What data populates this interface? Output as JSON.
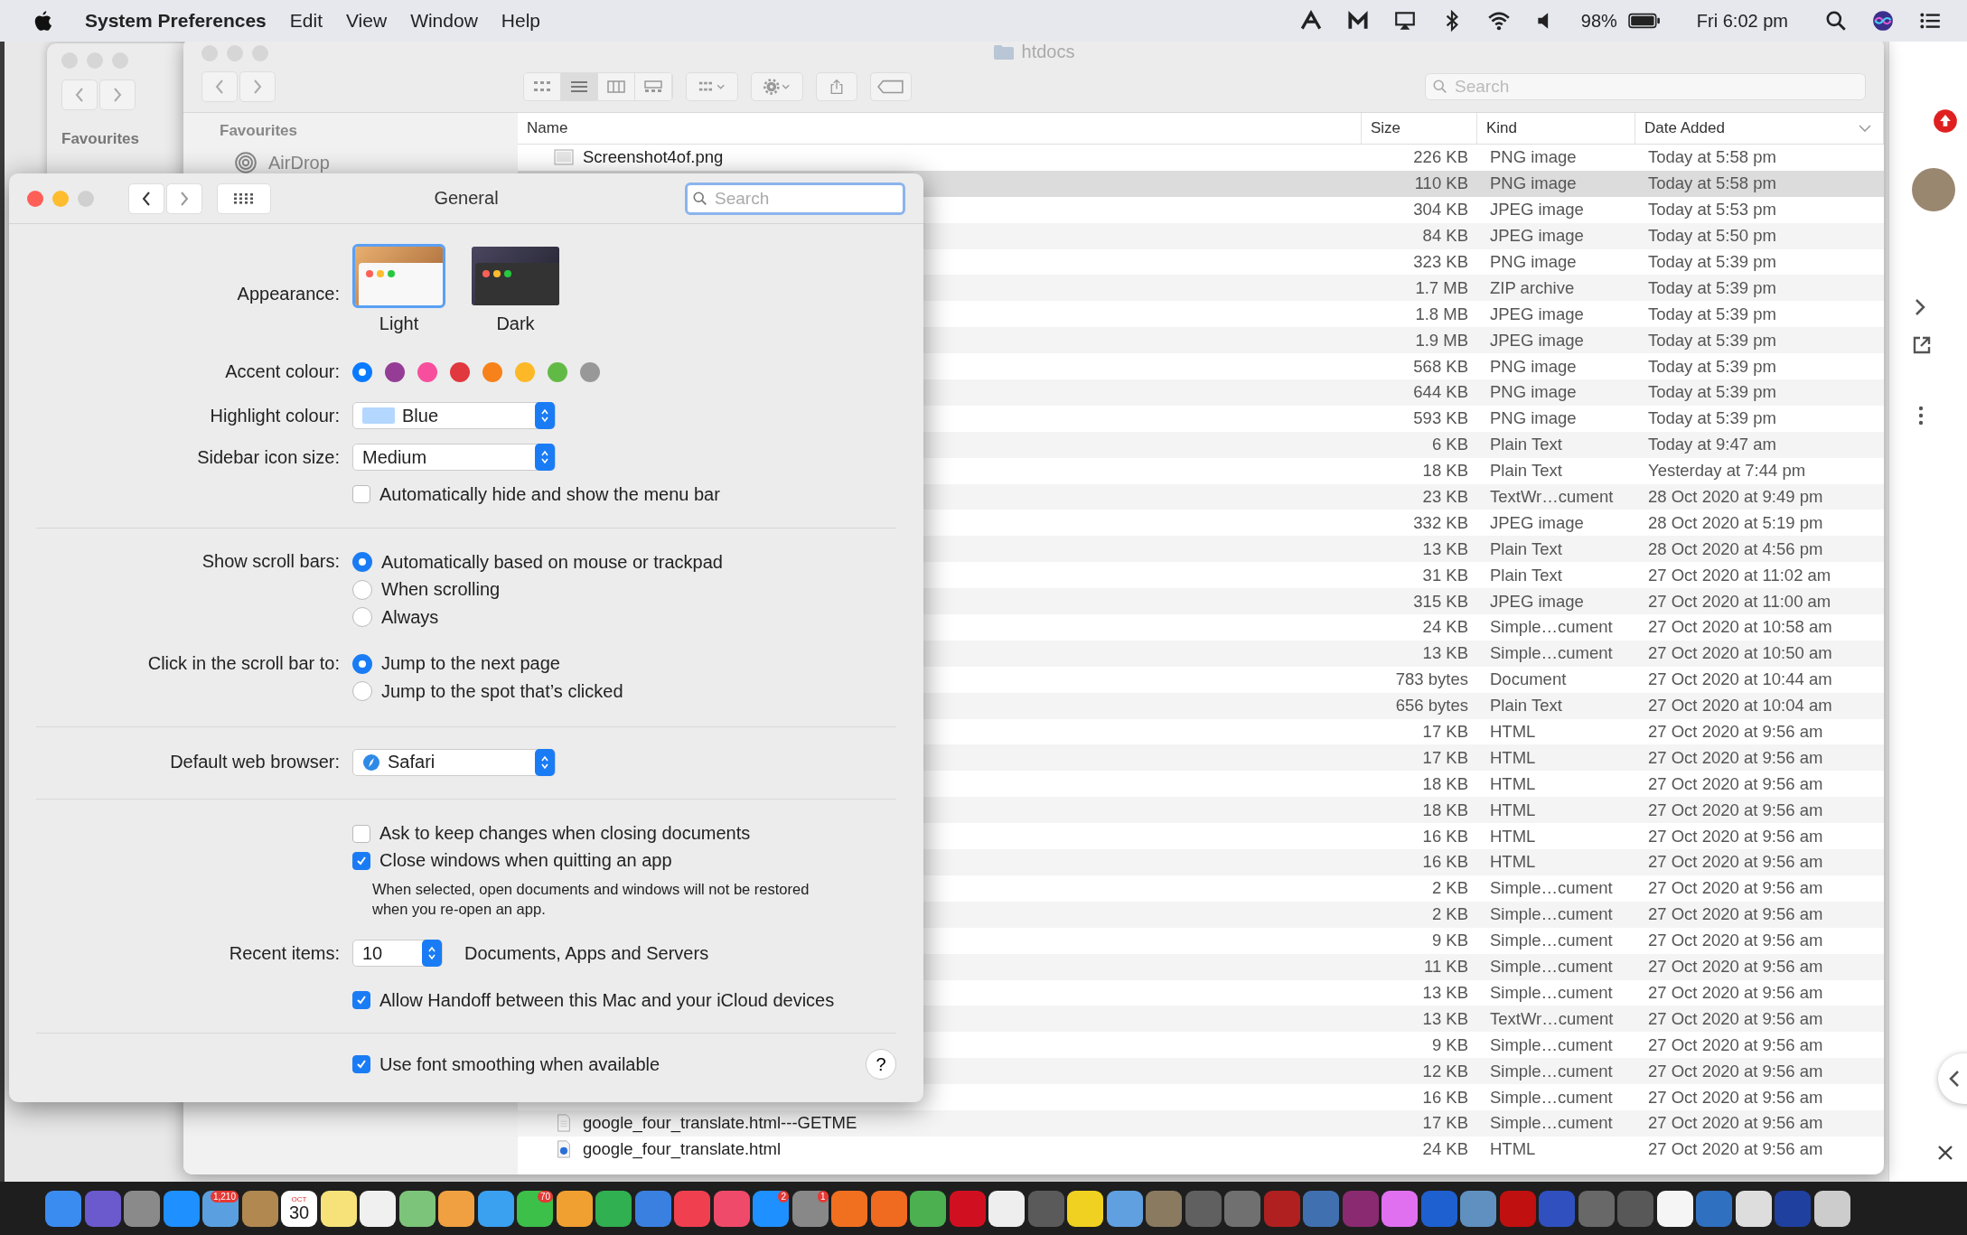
{
  "menu_bar": {
    "app_name": "System Preferences",
    "menus": [
      "Edit",
      "View",
      "Window",
      "Help"
    ],
    "battery": "98%",
    "clock": "Fri 6:02 pm"
  },
  "back_window": {
    "sidebar_heading": "Favourites"
  },
  "finder": {
    "title": "htdocs",
    "search": {
      "placeholder": "Search"
    },
    "sidebar": {
      "heading": "Favourites",
      "items": [
        {
          "label": "AirDrop"
        }
      ]
    },
    "columns": [
      "Name",
      "Size",
      "Kind",
      "Date Added"
    ],
    "rows": [
      {
        "kind": "image",
        "name": "Screenshot4of.png",
        "size": "226 KB",
        "file_kind": "PNG image",
        "date": "Today at 5:58 pm",
        "selected": false
      },
      {
        "kind": "hidden",
        "size": "110 KB",
        "file_kind": "PNG image",
        "date": "Today at 5:58 pm",
        "selected": true
      },
      {
        "kind": "hidden",
        "size": "304 KB",
        "file_kind": "JPEG image",
        "date": "Today at 5:53 pm",
        "selected": false
      },
      {
        "kind": "hidden",
        "size": "84 KB",
        "file_kind": "JPEG image",
        "date": "Today at 5:50 pm",
        "selected": false
      },
      {
        "kind": "hidden",
        "size": "323 KB",
        "file_kind": "PNG image",
        "date": "Today at 5:39 pm",
        "selected": false
      },
      {
        "kind": "hidden",
        "size": "1.7 MB",
        "file_kind": "ZIP archive",
        "date": "Today at 5:39 pm",
        "selected": false
      },
      {
        "kind": "hidden",
        "size": "1.8 MB",
        "file_kind": "JPEG image",
        "date": "Today at 5:39 pm",
        "selected": false
      },
      {
        "kind": "hidden",
        "size": "1.9 MB",
        "file_kind": "JPEG image",
        "date": "Today at 5:39 pm",
        "selected": false
      },
      {
        "kind": "hidden",
        "size": "568 KB",
        "file_kind": "PNG image",
        "date": "Today at 5:39 pm",
        "selected": false
      },
      {
        "kind": "hidden",
        "size": "644 KB",
        "file_kind": "PNG image",
        "date": "Today at 5:39 pm",
        "selected": false
      },
      {
        "kind": "hidden",
        "size": "593 KB",
        "file_kind": "PNG image",
        "date": "Today at 5:39 pm",
        "selected": false
      },
      {
        "kind": "hidden",
        "size": "6 KB",
        "file_kind": "Plain Text",
        "date": "Today at 9:47 am",
        "selected": false
      },
      {
        "kind": "hidden",
        "size": "18 KB",
        "file_kind": "Plain Text",
        "date": "Yesterday at 7:44 pm",
        "selected": false
      },
      {
        "kind": "hidden",
        "size": "23 KB",
        "file_kind": "TextWr…cument",
        "date": "28 Oct 2020 at 9:49 pm",
        "selected": false
      },
      {
        "kind": "hidden",
        "size": "332 KB",
        "file_kind": "JPEG image",
        "date": "28 Oct 2020 at 5:19 pm",
        "selected": false
      },
      {
        "kind": "hidden",
        "size": "13 KB",
        "file_kind": "Plain Text",
        "date": "28 Oct 2020 at 4:56 pm",
        "selected": false
      },
      {
        "kind": "hidden",
        "size": "31 KB",
        "file_kind": "Plain Text",
        "date": "27 Oct 2020 at 11:02 am",
        "selected": false
      },
      {
        "kind": "hidden",
        "size": "315 KB",
        "file_kind": "JPEG image",
        "date": "27 Oct 2020 at 11:00 am",
        "selected": false
      },
      {
        "kind": "hidden",
        "size": "24 KB",
        "file_kind": "Simple…cument",
        "date": "27 Oct 2020 at 10:58 am",
        "selected": false
      },
      {
        "kind": "hidden",
        "size": "13 KB",
        "file_kind": "Simple…cument",
        "date": "27 Oct 2020 at 10:50 am",
        "selected": false
      },
      {
        "kind": "hidden",
        "size": "783 bytes",
        "file_kind": "Document",
        "date": "27 Oct 2020 at 10:44 am",
        "selected": false
      },
      {
        "kind": "hidden",
        "size": "656 bytes",
        "file_kind": "Plain Text",
        "date": "27 Oct 2020 at 10:04 am",
        "selected": false
      },
      {
        "kind": "hidden",
        "size": "17 KB",
        "file_kind": "HTML",
        "date": "27 Oct 2020 at 9:56 am",
        "selected": false
      },
      {
        "kind": "hidden",
        "size": "17 KB",
        "file_kind": "HTML",
        "date": "27 Oct 2020 at 9:56 am",
        "selected": false
      },
      {
        "kind": "hidden",
        "size": "18 KB",
        "file_kind": "HTML",
        "date": "27 Oct 2020 at 9:56 am",
        "selected": false
      },
      {
        "kind": "hidden",
        "size": "18 KB",
        "file_kind": "HTML",
        "date": "27 Oct 2020 at 9:56 am",
        "selected": false
      },
      {
        "kind": "hidden",
        "size": "16 KB",
        "file_kind": "HTML",
        "date": "27 Oct 2020 at 9:56 am",
        "selected": false
      },
      {
        "kind": "hidden",
        "size": "16 KB",
        "file_kind": "HTML",
        "date": "27 Oct 2020 at 9:56 am",
        "selected": false
      },
      {
        "kind": "hidden",
        "size": "2 KB",
        "file_kind": "Simple…cument",
        "date": "27 Oct 2020 at 9:56 am",
        "selected": false
      },
      {
        "kind": "hidden",
        "size": "2 KB",
        "file_kind": "Simple…cument",
        "date": "27 Oct 2020 at 9:56 am",
        "selected": false
      },
      {
        "kind": "hidden",
        "size": "9 KB",
        "file_kind": "Simple…cument",
        "date": "27 Oct 2020 at 9:56 am",
        "selected": false
      },
      {
        "kind": "hidden",
        "size": "11 KB",
        "file_kind": "Simple…cument",
        "date": "27 Oct 2020 at 9:56 am",
        "selected": false
      },
      {
        "kind": "hidden",
        "size": "13 KB",
        "file_kind": "Simple…cument",
        "date": "27 Oct 2020 at 9:56 am",
        "selected": false
      },
      {
        "kind": "hidden",
        "size": "13 KB",
        "file_kind": "TextWr…cument",
        "date": "27 Oct 2020 at 9:56 am",
        "selected": false
      },
      {
        "kind": "hidden",
        "size": "9 KB",
        "file_kind": "Simple…cument",
        "date": "27 Oct 2020 at 9:56 am",
        "selected": false
      },
      {
        "kind": "hidden",
        "size": "12 KB",
        "file_kind": "Simple…cument",
        "date": "27 Oct 2020 at 9:56 am",
        "selected": false
      },
      {
        "kind": "hidden",
        "size": "16 KB",
        "file_kind": "Simple…cument",
        "date": "27 Oct 2020 at 9:56 am",
        "selected": false
      },
      {
        "kind": "document",
        "name": "google_four_translate.html---GETME",
        "size": "17 KB",
        "file_kind": "Simple…cument",
        "date": "27 Oct 2020 at 9:56 am",
        "selected": false
      },
      {
        "kind": "web",
        "name": "google_four_translate.html",
        "size": "24 KB",
        "file_kind": "HTML",
        "date": "27 Oct 2020 at 9:56 am",
        "selected": false
      }
    ]
  },
  "prefs": {
    "title": "General",
    "search": {
      "placeholder": "Search"
    },
    "appearance": {
      "label": "Appearance:",
      "options": [
        {
          "label": "Light",
          "kind": "light",
          "selected": true
        },
        {
          "label": "Dark",
          "kind": "dark",
          "selected": false
        }
      ]
    },
    "accent": {
      "label": "Accent colour:",
      "colors": [
        {
          "color": "#0a7aff",
          "selected": true
        },
        {
          "color": "#953d96",
          "selected": false
        },
        {
          "color": "#f74f9e",
          "selected": false
        },
        {
          "color": "#e0383e",
          "selected": false
        },
        {
          "color": "#f7821b",
          "selected": false
        },
        {
          "color": "#fcb827",
          "selected": false
        },
        {
          "color": "#62ba46",
          "selected": false
        },
        {
          "color": "#989898",
          "selected": false
        }
      ]
    },
    "highlight": {
      "label": "Highlight colour:",
      "value": "Blue"
    },
    "sidebar_icon_size": {
      "label": "Sidebar icon size:",
      "value": "Medium"
    },
    "auto_hide_menu_bar": {
      "label": "Automatically hide and show the menu bar",
      "checked": false
    },
    "scroll_bars": {
      "label": "Show scroll bars:",
      "options": [
        {
          "label": "Automatically based on mouse or trackpad",
          "selected": true
        },
        {
          "label": "When scrolling",
          "selected": false
        },
        {
          "label": "Always",
          "selected": false
        }
      ]
    },
    "click_scroll": {
      "label": "Click in the scroll bar to:",
      "options": [
        {
          "label": "Jump to the next page",
          "selected": true
        },
        {
          "label": "Jump to the spot that’s clicked",
          "selected": false
        }
      ]
    },
    "browser": {
      "label": "Default web browser:",
      "value": "Safari"
    },
    "ask_keep": {
      "label": "Ask to keep changes when closing documents",
      "checked": false
    },
    "close_windows": {
      "label": "Close windows when quitting an app",
      "checked": true,
      "note": "When selected, open documents and windows will not be restored when you re-open an app."
    },
    "recent": {
      "label": "Recent items:",
      "value": "10",
      "suffix": "Documents, Apps and Servers"
    },
    "handoff": {
      "label": "Allow Handoff between this Mac and your iCloud devices",
      "checked": true
    },
    "font_smoothing": {
      "label": "Use font smoothing when available",
      "checked": true
    },
    "help": "?"
  },
  "dock": {
    "items": [
      {
        "kind": "app",
        "color": "#3b8cf0"
      },
      {
        "kind": "app",
        "color": "#6a5acd"
      },
      {
        "kind": "app",
        "color": "#8a8a8a"
      },
      {
        "kind": "app",
        "color": "#1e90ff"
      },
      {
        "kind": "app",
        "color": "#5aa0e0",
        "badge": "1,210"
      },
      {
        "kind": "app",
        "color": "#b08850"
      },
      {
        "kind": "calendar",
        "color": "#ffffff",
        "month": "OCT",
        "day": "30"
      },
      {
        "kind": "app",
        "color": "#f7e27a"
      },
      {
        "kind": "app",
        "color": "#f0f0f0"
      },
      {
        "kind": "app",
        "color": "#7cc47a"
      },
      {
        "kind": "app",
        "color": "#f0a040"
      },
      {
        "kind": "app",
        "color": "#3aa0f0"
      },
      {
        "kind": "app",
        "color": "#3cc04a",
        "badge": "70"
      },
      {
        "kind": "app",
        "color": "#f0a030"
      },
      {
        "kind": "app",
        "color": "#30b050"
      },
      {
        "kind": "app",
        "color": "#3a80e0"
      },
      {
        "kind": "app",
        "color": "#f04050"
      },
      {
        "kind": "app",
        "color": "#f04a6a"
      },
      {
        "kind": "app",
        "color": "#1e90ff",
        "badge": "2"
      },
      {
        "kind": "app",
        "color": "#888888",
        "badge": "1"
      },
      {
        "kind": "app",
        "color": "#f07020"
      },
      {
        "kind": "app",
        "color": "#f06a20"
      },
      {
        "kind": "app",
        "color": "#4caf50"
      },
      {
        "kind": "app",
        "color": "#d01020"
      },
      {
        "kind": "app",
        "color": "#eeeeee"
      },
      {
        "kind": "app",
        "color": "#5a5a5a"
      },
      {
        "kind": "app",
        "color": "#f0d020"
      },
      {
        "kind": "app",
        "color": "#60a0e0"
      },
      {
        "kind": "app",
        "color": "#8a7a60"
      },
      {
        "kind": "app",
        "color": "#606060"
      },
      {
        "kind": "app",
        "color": "#707070"
      },
      {
        "kind": "app",
        "color": "#b02020"
      },
      {
        "kind": "app",
        "color": "#4070b0"
      },
      {
        "kind": "app",
        "color": "#8a2a70"
      },
      {
        "kind": "app",
        "color": "#e070f0"
      },
      {
        "kind": "app",
        "color": "#1e60d0"
      },
      {
        "kind": "app",
        "color": "#6090c0"
      },
      {
        "kind": "app",
        "color": "#c01010"
      },
      {
        "kind": "app",
        "color": "#3050c0"
      },
      {
        "kind": "app",
        "color": "#686868"
      },
      {
        "kind": "app",
        "color": "#585858"
      },
      {
        "kind": "app",
        "color": "#f5f5f5"
      },
      {
        "kind": "app",
        "color": "#3070c0"
      },
      {
        "kind": "app",
        "color": "#dddddd"
      },
      {
        "kind": "app",
        "color": "#2040a0"
      },
      {
        "kind": "app",
        "color": "#cccccc"
      }
    ]
  }
}
